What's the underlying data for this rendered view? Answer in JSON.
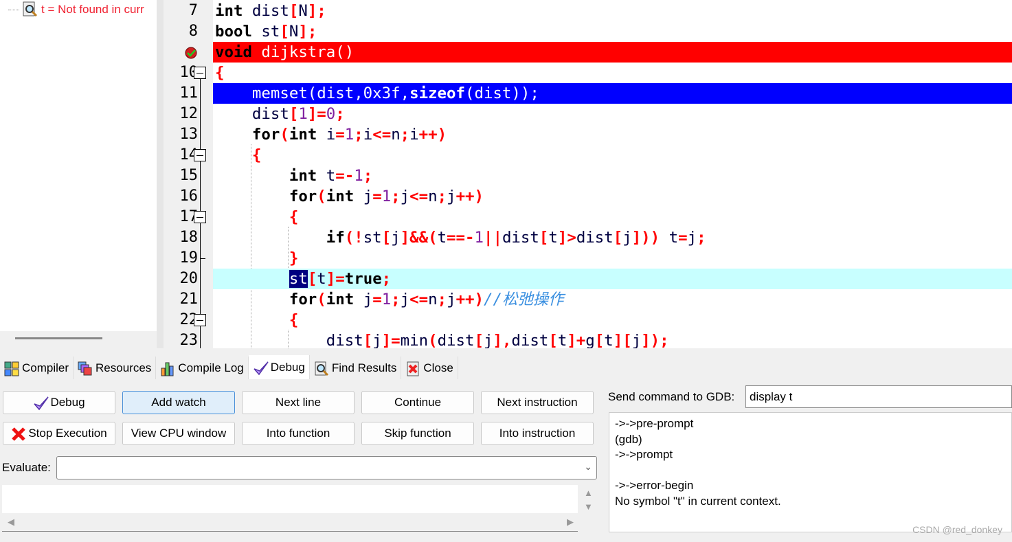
{
  "watch_panel": {
    "item": "t = Not found in curr"
  },
  "editor": {
    "lines": [
      {
        "no": "7",
        "tokens": [
          [
            "int",
            "k"
          ],
          [
            " dist",
            "i"
          ],
          [
            "[",
            "o"
          ],
          [
            "N",
            "i"
          ],
          [
            "];",
            "o"
          ]
        ]
      },
      {
        "no": "8",
        "tokens": [
          [
            "bool",
            "k"
          ],
          [
            " st",
            "i"
          ],
          [
            "[",
            "o"
          ],
          [
            "N",
            "i"
          ],
          [
            "];",
            "o"
          ]
        ]
      },
      {
        "no": "",
        "marker": "breakpoint",
        "style": "bp",
        "tokens": [
          [
            "void",
            "k"
          ],
          [
            " dijkstra()",
            ""
          ]
        ]
      },
      {
        "no": "10",
        "fold": true,
        "tokens": [
          [
            "{",
            "o"
          ]
        ]
      },
      {
        "no": "11",
        "marker": "exec-arrow",
        "style": "exec",
        "tokens": [
          [
            "    memset(dist,0x3f,",
            ""
          ],
          [
            "sizeof",
            "k2"
          ],
          [
            "(dist));",
            ""
          ]
        ]
      },
      {
        "no": "12",
        "tokens": [
          [
            "    dist",
            "i"
          ],
          [
            "[",
            "o"
          ],
          [
            "1",
            "n"
          ],
          [
            "]=",
            "o"
          ],
          [
            "0",
            "n"
          ],
          [
            ";",
            "o"
          ]
        ]
      },
      {
        "no": "13",
        "tokens": [
          [
            "    for",
            "k"
          ],
          [
            "(",
            "o"
          ],
          [
            "int",
            "k"
          ],
          [
            " i",
            "i"
          ],
          [
            "=",
            "o"
          ],
          [
            "1",
            "n"
          ],
          [
            ";",
            "o"
          ],
          [
            "i",
            "i"
          ],
          [
            "<=",
            "o"
          ],
          [
            "n",
            "i"
          ],
          [
            ";",
            "o"
          ],
          [
            "i",
            "i"
          ],
          [
            "++)",
            "o"
          ]
        ]
      },
      {
        "no": "14",
        "fold": true,
        "tokens": [
          [
            "    {",
            "o"
          ]
        ]
      },
      {
        "no": "15",
        "tokens": [
          [
            "        int",
            "k"
          ],
          [
            " t",
            "i"
          ],
          [
            "=-",
            "o"
          ],
          [
            "1",
            "n"
          ],
          [
            ";",
            "o"
          ]
        ]
      },
      {
        "no": "16",
        "tokens": [
          [
            "        for",
            "k"
          ],
          [
            "(",
            "o"
          ],
          [
            "int",
            "k"
          ],
          [
            " j",
            "i"
          ],
          [
            "=",
            "o"
          ],
          [
            "1",
            "n"
          ],
          [
            ";",
            "o"
          ],
          [
            "j",
            "i"
          ],
          [
            "<=",
            "o"
          ],
          [
            "n",
            "i"
          ],
          [
            ";",
            "o"
          ],
          [
            "j",
            "i"
          ],
          [
            "++)",
            "o"
          ]
        ]
      },
      {
        "no": "17",
        "fold": true,
        "tokens": [
          [
            "        {",
            "o"
          ]
        ]
      },
      {
        "no": "18",
        "tokens": [
          [
            "            if",
            "k"
          ],
          [
            "(!",
            "o"
          ],
          [
            "st",
            "i"
          ],
          [
            "[",
            "o"
          ],
          [
            "j",
            "i"
          ],
          [
            "]&&(",
            "o"
          ],
          [
            "t",
            "i"
          ],
          [
            "==-",
            "o"
          ],
          [
            "1",
            "n"
          ],
          [
            "||",
            "o"
          ],
          [
            "dist",
            "i"
          ],
          [
            "[",
            "o"
          ],
          [
            "t",
            "i"
          ],
          [
            "]>",
            "o"
          ],
          [
            "dist",
            "i"
          ],
          [
            "[",
            "o"
          ],
          [
            "j",
            "i"
          ],
          [
            "]))",
            "o"
          ],
          [
            " t",
            "i"
          ],
          [
            "=",
            "o"
          ],
          [
            "j",
            "i"
          ],
          [
            ";",
            "o"
          ]
        ]
      },
      {
        "no": "19",
        "foldend": true,
        "tokens": [
          [
            "        }",
            "o"
          ]
        ]
      },
      {
        "no": "20",
        "style": "cur",
        "tokens": [
          [
            "        ",
            ""
          ],
          [
            "st",
            "sel"
          ],
          [
            "[",
            "o"
          ],
          [
            "t",
            "i"
          ],
          [
            "]=",
            "o"
          ],
          [
            "true",
            "k"
          ],
          [
            ";",
            "o"
          ]
        ]
      },
      {
        "no": "21",
        "tokens": [
          [
            "        for",
            "k"
          ],
          [
            "(",
            "o"
          ],
          [
            "int",
            "k"
          ],
          [
            " j",
            "i"
          ],
          [
            "=",
            "o"
          ],
          [
            "1",
            "n"
          ],
          [
            ";",
            "o"
          ],
          [
            "j",
            "i"
          ],
          [
            "<=",
            "o"
          ],
          [
            "n",
            "i"
          ],
          [
            ";",
            "o"
          ],
          [
            "j",
            "i"
          ],
          [
            "++)",
            "o"
          ],
          [
            "//松弛操作",
            "c"
          ]
        ]
      },
      {
        "no": "22",
        "fold": true,
        "tokens": [
          [
            "        {",
            "o"
          ]
        ]
      },
      {
        "no": "23",
        "tokens": [
          [
            "            dist",
            "i"
          ],
          [
            "[",
            "o"
          ],
          [
            "j",
            "i"
          ],
          [
            "]=",
            "o"
          ],
          [
            "min",
            "i"
          ],
          [
            "(",
            "o"
          ],
          [
            "dist",
            "i"
          ],
          [
            "[",
            "o"
          ],
          [
            "j",
            "i"
          ],
          [
            "],",
            "o"
          ],
          [
            "dist",
            "i"
          ],
          [
            "[",
            "o"
          ],
          [
            "t",
            "i"
          ],
          [
            "]+",
            "o"
          ],
          [
            "g",
            "i"
          ],
          [
            "[",
            "o"
          ],
          [
            "t",
            "i"
          ],
          [
            "][",
            "o"
          ],
          [
            "j",
            "i"
          ],
          [
            "]);",
            "o"
          ]
        ]
      }
    ]
  },
  "tabs": [
    {
      "label": "Compiler",
      "icon": "grid-icon"
    },
    {
      "label": "Resources",
      "icon": "resources-icon"
    },
    {
      "label": "Compile Log",
      "icon": "bar-chart-icon"
    },
    {
      "label": "Debug",
      "icon": "checkmark-icon",
      "active": true
    },
    {
      "label": "Find Results",
      "icon": "find-icon"
    },
    {
      "label": "Close",
      "icon": "close-icon"
    }
  ],
  "debug": {
    "buttons": [
      {
        "label": "Debug",
        "icon": "checkmark-icon"
      },
      {
        "label": "Add watch",
        "highlight": true
      },
      {
        "label": "Next line"
      },
      {
        "label": "Continue"
      },
      {
        "label": "Next instruction"
      },
      {
        "label": "Stop Execution",
        "icon": "red-x-icon"
      },
      {
        "label": "View CPU window"
      },
      {
        "label": "Into function"
      },
      {
        "label": "Skip function"
      },
      {
        "label": "Into instruction"
      }
    ],
    "evaluate_label": "Evaluate:",
    "evaluate_value": "",
    "gdb_label": "Send command to GDB:",
    "gdb_value": "display t",
    "gdb_output": "->->pre-prompt\n(gdb)\n->->prompt\n\n->->error-begin\nNo symbol \"t\" in current context."
  },
  "watermark": "CSDN @red_donkey",
  "colors": {
    "breakpoint_line": "#ff0000",
    "exec_line": "#0000ff",
    "current_line": "#c8ffff",
    "watch_error": "#f02030"
  }
}
